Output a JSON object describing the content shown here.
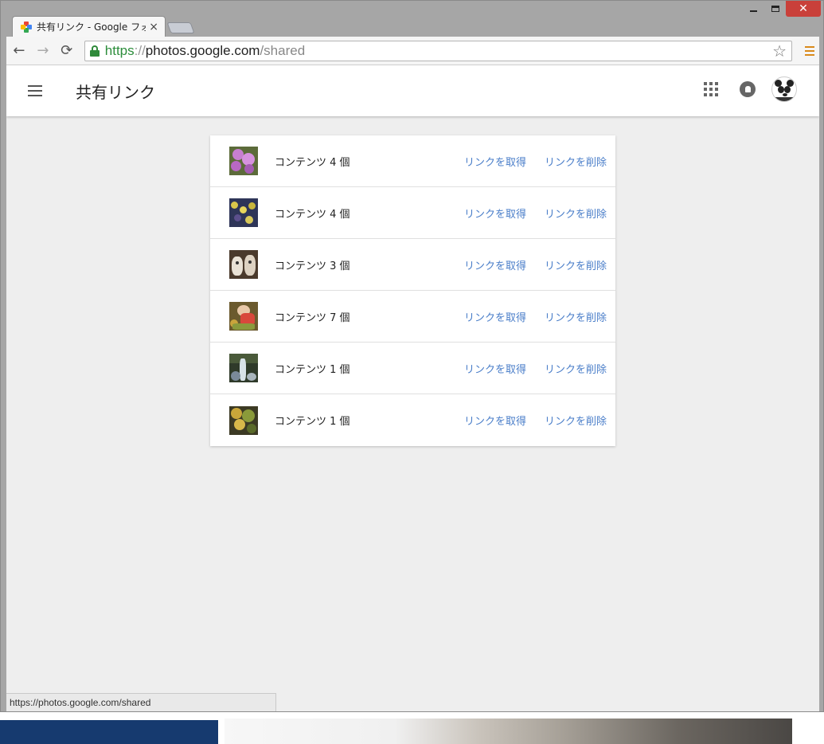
{
  "browser": {
    "tab_title": "共有リンク - Google フォト",
    "tab_close": "×",
    "url": {
      "scheme": "https",
      "separator": "://",
      "host": "photos.google.com",
      "path": "/shared"
    },
    "status_url": "https://photos.google.com/shared",
    "star": "☆",
    "back": "←",
    "forward": "→",
    "reload": "⟳"
  },
  "window_controls": {
    "minimize": "",
    "maximize": "",
    "close": "✕"
  },
  "header": {
    "title": "共有リンク"
  },
  "shared_links": [
    {
      "count_label": "コンテンツ 4 個",
      "get_label": "リンクを取得",
      "delete_label": "リンクを削除",
      "thumb": "flower-pink"
    },
    {
      "count_label": "コンテンツ 4 個",
      "get_label": "リンクを取得",
      "delete_label": "リンクを削除",
      "thumb": "flower-bed"
    },
    {
      "count_label": "コンテンツ 3 個",
      "get_label": "リンクを取得",
      "delete_label": "リンクを削除",
      "thumb": "toy-figures"
    },
    {
      "count_label": "コンテンツ 7 個",
      "get_label": "リンクを取得",
      "delete_label": "リンクを削除",
      "thumb": "red-figure"
    },
    {
      "count_label": "コンテンツ 1 個",
      "get_label": "リンクを取得",
      "delete_label": "リンクを削除",
      "thumb": "waterfall"
    },
    {
      "count_label": "コンテンツ 1 個",
      "get_label": "リンクを取得",
      "delete_label": "リンクを削除",
      "thumb": "autumn-trees"
    }
  ],
  "colors": {
    "link": "#4a7ec9",
    "page_bg": "#eeeeee",
    "secure_green": "#2c8d3b"
  }
}
